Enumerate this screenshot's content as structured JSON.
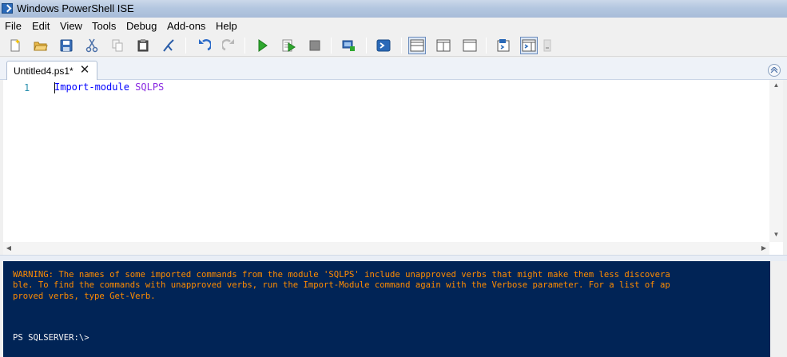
{
  "window": {
    "title": "Windows PowerShell ISE"
  },
  "menu": {
    "items": [
      "File",
      "Edit",
      "View",
      "Tools",
      "Debug",
      "Add-ons",
      "Help"
    ]
  },
  "toolbar": {
    "buttons": [
      "new-file-icon",
      "open-folder-icon",
      "save-icon",
      "cut-icon",
      "copy-icon",
      "paste-icon",
      "clear-console-icon",
      "undo-icon",
      "redo-icon",
      "run-script-icon",
      "run-selection-icon",
      "stop-icon",
      "remote-powershell-icon",
      "powershell-console-icon",
      "layout-script-top-icon",
      "layout-script-right-icon",
      "layout-script-max-icon",
      "show-command-icon",
      "show-command-addon-icon"
    ]
  },
  "tab": {
    "label": "Untitled4.ps1*",
    "close": "✕"
  },
  "editor": {
    "line_number": "1",
    "code_command": "Import-module",
    "code_argument": "SQLPS"
  },
  "console": {
    "warning_lines": [
      "WARNING: The names of some imported commands from the module 'SQLPS' include unapproved verbs that might make them less discovera",
      "ble. To find the commands with unapproved verbs, run the Import-Module command again with the Verbose parameter. For a list of ap",
      "proved verbs, type Get-Verb."
    ],
    "prompt": "PS SQLSERVER:\\>"
  },
  "colors": {
    "console_bg": "#012456",
    "warning_text": "#ff8c00",
    "cmdlet": "#0000ff",
    "argument": "#8a2be2",
    "line_number": "#2b91af"
  }
}
